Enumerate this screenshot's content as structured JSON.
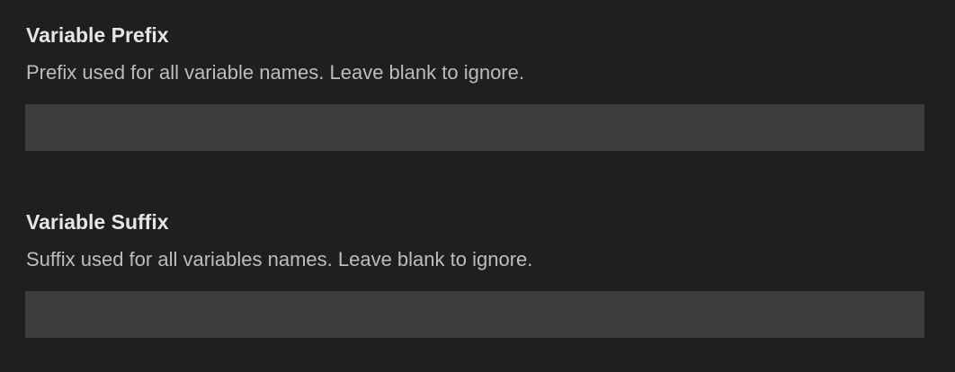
{
  "settings": [
    {
      "title": "Variable Prefix",
      "description": "Prefix used for all variable names. Leave blank to ignore.",
      "value": ""
    },
    {
      "title": "Variable Suffix",
      "description": "Suffix used for all variables names. Leave blank to ignore.",
      "value": ""
    }
  ]
}
